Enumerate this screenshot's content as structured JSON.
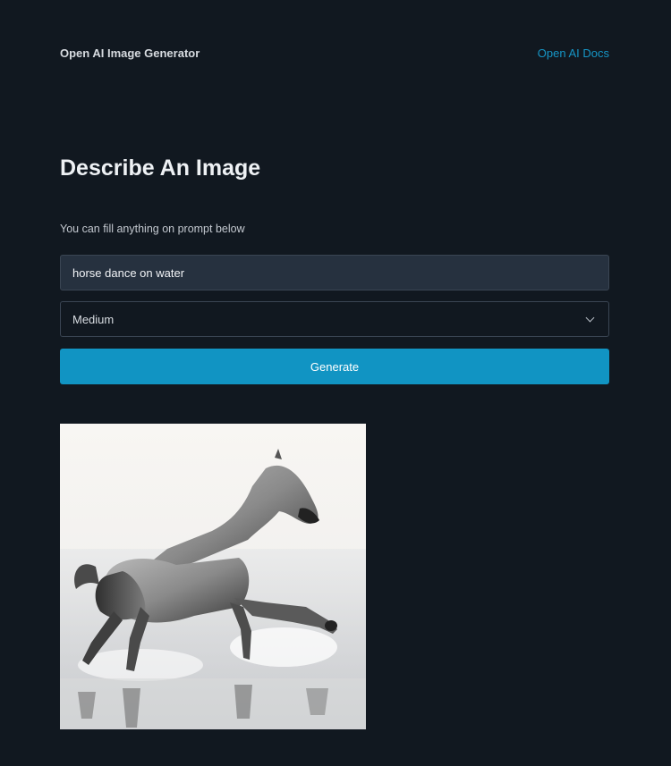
{
  "header": {
    "brand": "Open AI Image Generator",
    "docs_link": "Open AI Docs"
  },
  "main": {
    "title": "Describe An Image",
    "subtitle": "You can fill anything on prompt below",
    "prompt_value": "horse dance on water",
    "size_selected": "Medium",
    "generate_label": "Generate"
  },
  "colors": {
    "background": "#111820",
    "accent": "#1194c3",
    "link": "#1696c6",
    "input_bg": "#26313f"
  },
  "icons": {
    "select": "chevron-down-icon"
  }
}
